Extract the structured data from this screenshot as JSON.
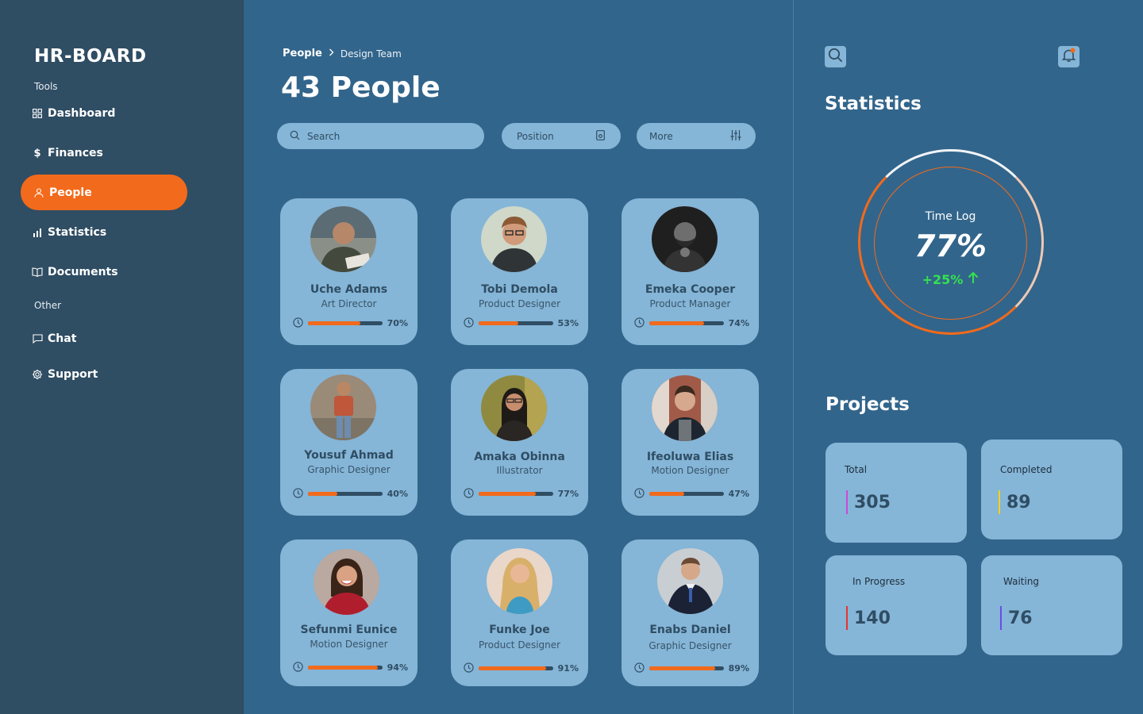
{
  "sidebar": {
    "brand": "HR-BOARD",
    "tools_label": "Tools",
    "other_label": "Other",
    "items": [
      {
        "label": "Dashboard",
        "icon": "grid-icon"
      },
      {
        "label": "Finances",
        "icon": "dollar-icon"
      },
      {
        "label": "People",
        "icon": "user-icon",
        "active": true
      },
      {
        "label": "Statistics",
        "icon": "bar-chart-icon"
      },
      {
        "label": "Documents",
        "icon": "book-icon"
      },
      {
        "label": "Chat",
        "icon": "chat-icon"
      },
      {
        "label": "Support",
        "icon": "gear-icon"
      }
    ]
  },
  "breadcrumb": {
    "root": "People",
    "current": "Design Team"
  },
  "page_title": "43 People",
  "filters": {
    "search_placeholder": "Search",
    "position_label": "Position",
    "more_label": "More"
  },
  "people": [
    {
      "name": "Uche Adams",
      "role": "Art Director",
      "progress": 70,
      "progress_label": "70%"
    },
    {
      "name": "Tobi Demola",
      "role": "Product Designer",
      "progress": 53,
      "progress_label": "53%"
    },
    {
      "name": "Emeka Cooper",
      "role": "Product Manager",
      "progress": 74,
      "progress_label": "74%"
    },
    {
      "name": "Yousuf Ahmad",
      "role": "Graphic Designer",
      "progress": 40,
      "progress_label": "40%"
    },
    {
      "name": "Amaka Obinna",
      "role": "Illustrator",
      "progress": 77,
      "progress_label": "77%"
    },
    {
      "name": "Ifeoluwa Elias",
      "role": "Motion Designer",
      "progress": 47,
      "progress_label": "47%"
    },
    {
      "name": "Sefunmi Eunice",
      "role": "Motion Designer",
      "progress": 94,
      "progress_label": "94%"
    },
    {
      "name": "Funke Joe",
      "role": "Product Designer",
      "progress": 91,
      "progress_label": "91%"
    },
    {
      "name": "Enabs Daniel",
      "role": "Graphic Designer",
      "progress": 89,
      "progress_label": "89%"
    }
  ],
  "statistics": {
    "title": "Statistics",
    "time_log_label": "Time Log",
    "time_log_value": "77%",
    "time_log_change": "+25%"
  },
  "projects": {
    "title": "Projects",
    "items": [
      {
        "label": "Total",
        "value": "305",
        "accent": "#c94bd6"
      },
      {
        "label": "Completed",
        "value": "89",
        "accent": "#f2d21b"
      },
      {
        "label": "In Progress",
        "value": "140",
        "accent": "#e8322e"
      },
      {
        "label": "Waiting",
        "value": "76",
        "accent": "#6b4be8"
      }
    ]
  },
  "colors": {
    "accent": "#f26a1b",
    "sidebar": "#2f4d63",
    "main": "#32658b",
    "card": "#85b5d7",
    "positive": "#34e24e"
  }
}
